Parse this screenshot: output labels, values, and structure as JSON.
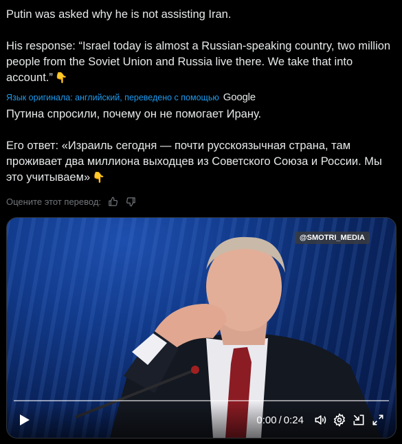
{
  "post": {
    "line1": "Putin was asked why he is not assisting Iran.",
    "line2": "His response: “Israel today is almost a Russian-speaking country, two million people from the Soviet Union and Russia live there. We take that into account.”",
    "emoji": "👇"
  },
  "translation_note": {
    "text": "Язык оригинала: английский, переведено с помощью",
    "provider": "Google"
  },
  "translated": {
    "line1": "Путина спросили, почему он не помогает Ирану.",
    "line2": "Его ответ: «Израиль сегодня — почти русскоязычная страна, там проживает два миллиона выходцев из Советского Союза и России. Мы это учитываем»",
    "emoji": "👇"
  },
  "rate": {
    "label": "Оцените этот перевод:",
    "like_icon": "thumbs-up-icon",
    "dislike_icon": "thumbs-down-icon"
  },
  "video": {
    "watermark": "@SMOTRI_MEDIA",
    "time_current": "0:00",
    "time_separator": "/",
    "time_total": "0:24",
    "progress": 0,
    "icons": [
      "play-icon",
      "volume-icon",
      "settings-icon",
      "picture-in-picture-icon",
      "fullscreen-icon"
    ]
  },
  "colors": {
    "accent": "#1d9bf0",
    "muted": "#71767b",
    "text": "#e7e9ea"
  }
}
